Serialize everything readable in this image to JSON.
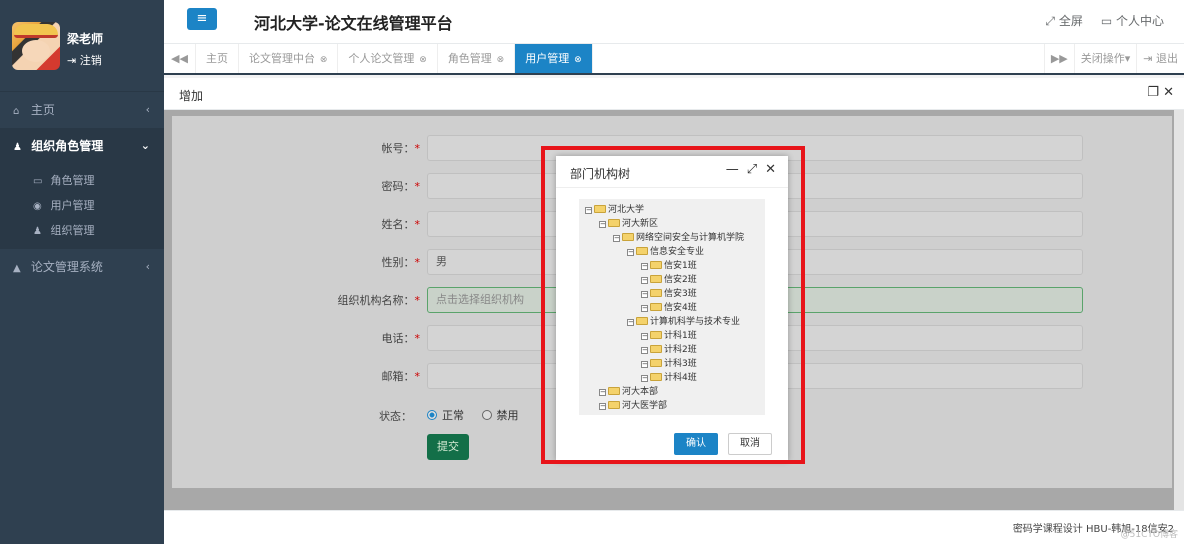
{
  "user": {
    "name": "梁老师",
    "logout_label": "注销"
  },
  "sidebar": {
    "items": [
      {
        "label": "主页",
        "caret": "‹"
      },
      {
        "label": "组织角色管理",
        "caret": "⌄"
      },
      {
        "label": "论文管理系统",
        "caret": "‹"
      }
    ],
    "sub_items": [
      {
        "label": "角色管理"
      },
      {
        "label": "用户管理"
      },
      {
        "label": "组织管理"
      }
    ]
  },
  "header": {
    "menu_icon": "≡",
    "title": "河北大学-论文在线管理平台",
    "fullscreen": "全屏",
    "profile": "个人中心"
  },
  "tabs": {
    "items": [
      {
        "label": "主页",
        "closable": false
      },
      {
        "label": "论文管理中台",
        "closable": true
      },
      {
        "label": "个人论文管理",
        "closable": true
      },
      {
        "label": "角色管理",
        "closable": true
      },
      {
        "label": "用户管理",
        "closable": true,
        "active": true
      }
    ],
    "close_ops": "关闭操作",
    "exit": "退出"
  },
  "panel": {
    "title": "增加"
  },
  "form": {
    "fields": [
      {
        "label": "帐号：",
        "required": true,
        "value": ""
      },
      {
        "label": "密码：",
        "required": true,
        "value": ""
      },
      {
        "label": "姓名：",
        "required": true,
        "value": ""
      },
      {
        "label": "性别：",
        "required": true,
        "value": "男"
      },
      {
        "label": "组织机构名称：",
        "required": true,
        "placeholder": "点击选择组织机构"
      },
      {
        "label": "电话：",
        "required": true,
        "value": ""
      },
      {
        "label": "邮箱：",
        "required": true,
        "value": ""
      }
    ],
    "status_label": "状态：",
    "status_options": [
      "正常",
      "禁用"
    ],
    "status_selected": "正常",
    "submit_label": "提交"
  },
  "dialog": {
    "title": "部门机构树",
    "tree": [
      {
        "label": "河北大学",
        "level": 0
      },
      {
        "label": "河大新区",
        "level": 1
      },
      {
        "label": "网络空间安全与计算机学院",
        "level": 2
      },
      {
        "label": "信息安全专业",
        "level": 3
      },
      {
        "label": "信安1班",
        "level": 4
      },
      {
        "label": "信安2班",
        "level": 4
      },
      {
        "label": "信安3班",
        "level": 4
      },
      {
        "label": "信安4班",
        "level": 4
      },
      {
        "label": "计算机科学与技术专业",
        "level": 3
      },
      {
        "label": "计科1班",
        "level": 4
      },
      {
        "label": "计科2班",
        "level": 4
      },
      {
        "label": "计科3班",
        "level": 4
      },
      {
        "label": "计科4班",
        "level": 4
      },
      {
        "label": "河大本部",
        "level": 1
      },
      {
        "label": "河大医学部",
        "level": 1
      }
    ],
    "ok_label": "确认",
    "cancel_label": "取消"
  },
  "footer": {
    "text": "密码学课程设计 HBU-韩旭-18信安2"
  },
  "watermark": "@51CTO博客",
  "colors": {
    "primary": "#1c84c6",
    "sidebar": "#2f4050",
    "highlight": "#e8141a",
    "submit": "#136f48"
  }
}
